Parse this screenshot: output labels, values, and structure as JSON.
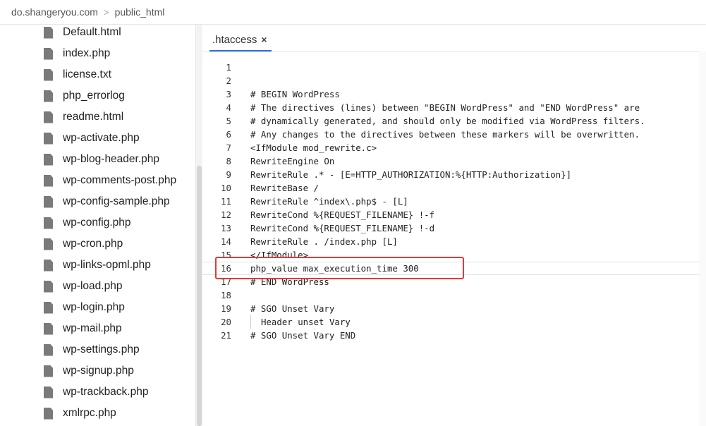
{
  "breadcrumb": {
    "domain": "do.shangeryou.com",
    "separator": ">",
    "folder": "public_html"
  },
  "files": [
    "Default.html",
    "index.php",
    "license.txt",
    "php_errorlog",
    "readme.html",
    "wp-activate.php",
    "wp-blog-header.php",
    "wp-comments-post.php",
    "wp-config-sample.php",
    "wp-config.php",
    "wp-cron.php",
    "wp-links-opml.php",
    "wp-load.php",
    "wp-login.php",
    "wp-mail.php",
    "wp-settings.php",
    "wp-signup.php",
    "wp-trackback.php",
    "xmlrpc.php"
  ],
  "editor": {
    "tab": {
      "label": ".htaccess",
      "close": "×"
    },
    "current_line": 16,
    "lines": [
      "",
      "",
      "# BEGIN WordPress",
      "# The directives (lines) between \"BEGIN WordPress\" and \"END WordPress\" are",
      "# dynamically generated, and should only be modified via WordPress filters.",
      "# Any changes to the directives between these markers will be overwritten.",
      "<IfModule mod_rewrite.c>",
      "RewriteEngine On",
      "RewriteRule .* - [E=HTTP_AUTHORIZATION:%{HTTP:Authorization}]",
      "RewriteBase /",
      "RewriteRule ^index\\.php$ - [L]",
      "RewriteCond %{REQUEST_FILENAME} !-f",
      "RewriteCond %{REQUEST_FILENAME} !-d",
      "RewriteRule . /index.php [L]",
      "</IfModule>",
      "php_value max_execution_time 300",
      "# END WordPress",
      "",
      "# SGO Unset Vary",
      "Header unset Vary",
      "# SGO Unset Vary END"
    ]
  },
  "colors": {
    "highlight": "#e53935",
    "tab_accent": "#2f6fd6",
    "file_icon": "#7a7a7a"
  }
}
